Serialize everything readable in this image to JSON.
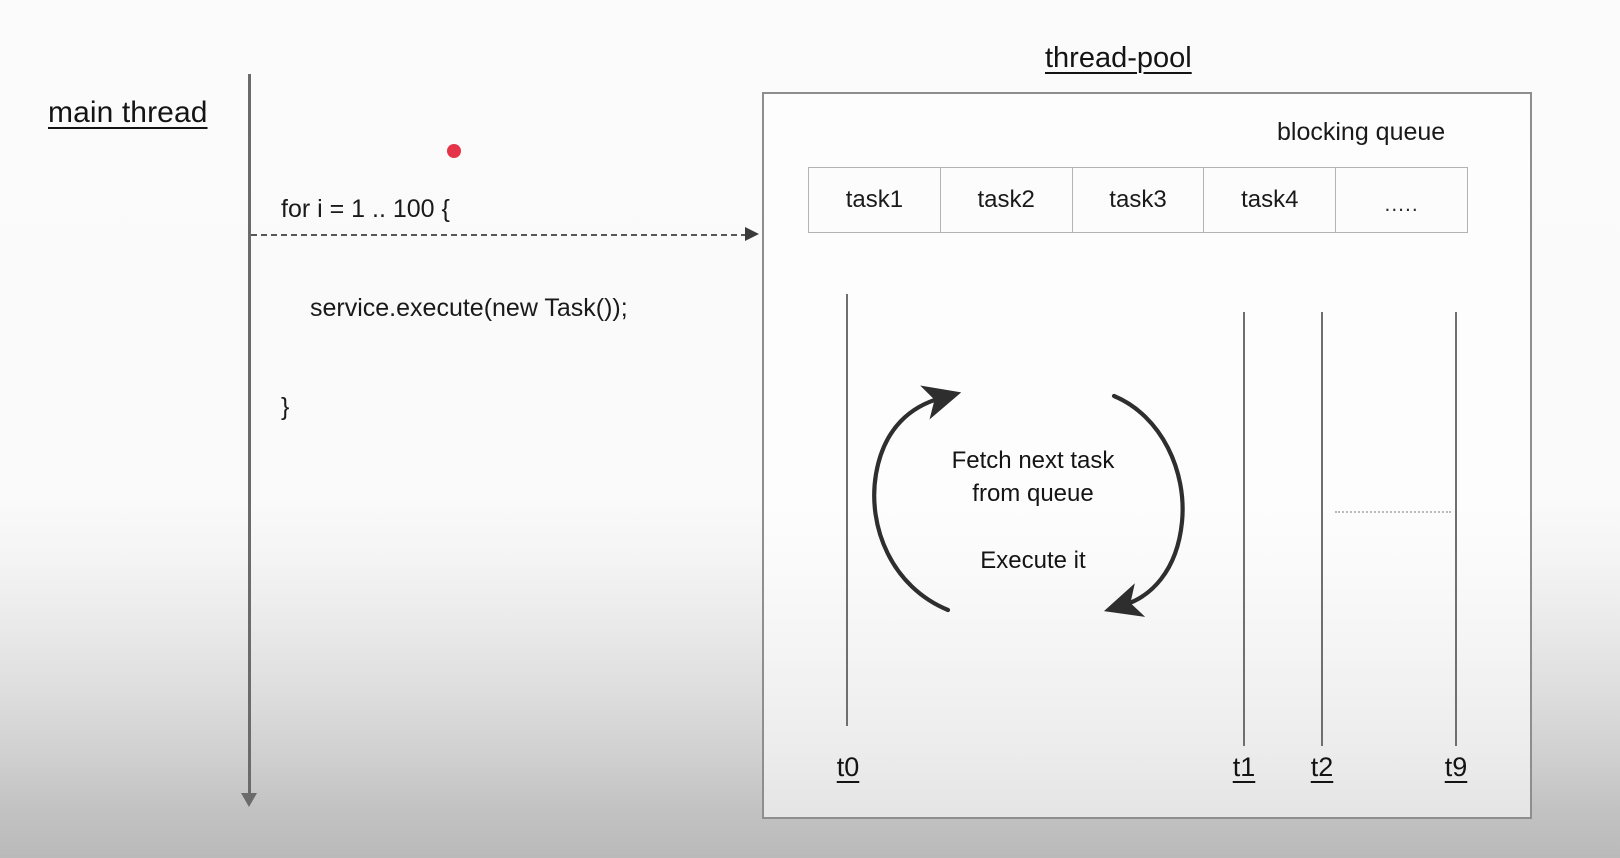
{
  "main_thread": {
    "label": "main thread",
    "code": {
      "line1": "for i = 1 .. 100 {",
      "line2": "service.execute(new Task());",
      "line3": "}"
    }
  },
  "thread_pool": {
    "title": "thread-pool",
    "blocking_queue": {
      "label": "blocking queue",
      "cells": [
        {
          "label": "task1"
        },
        {
          "label": "task2"
        },
        {
          "label": "task3"
        },
        {
          "label": "task4"
        },
        {
          "label": "....."
        }
      ]
    },
    "workers": [
      {
        "id": "t0",
        "label": "t0"
      },
      {
        "id": "t1",
        "label": "t1"
      },
      {
        "id": "t2",
        "label": "t2"
      },
      {
        "id": "t9",
        "label": "t9"
      }
    ],
    "execution_loop": {
      "fetch_line1": "Fetch next task",
      "fetch_line2": "from queue",
      "execute": "Execute it"
    }
  },
  "colors": {
    "cursor_dot": "#e5334a",
    "ink": "#1a1a1a",
    "line": "#6f6f6f",
    "box_border": "#8e8e8e"
  }
}
